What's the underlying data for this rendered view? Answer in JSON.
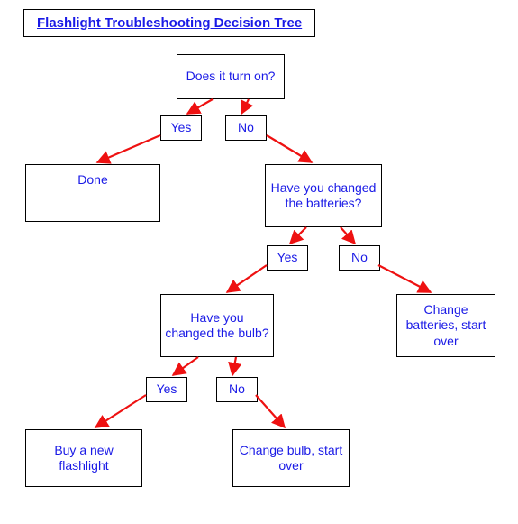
{
  "title": "Flashlight Troubleshooting Decision Tree",
  "nodes": {
    "q1": "Does it turn on?",
    "q1_yes": "Yes",
    "q1_no": "No",
    "done": "Done",
    "q2": "Have you changed the batteries?",
    "q2_yes": "Yes",
    "q2_no": "No",
    "change_batt": "Change batteries, start over",
    "q3": "Have you changed the bulb?",
    "q3_yes": "Yes",
    "q3_no": "No",
    "buy_new": "Buy a new flashlight",
    "change_bulb": "Change bulb, start over"
  },
  "chart_data": {
    "type": "decision-tree",
    "title": "Flashlight Troubleshooting Decision Tree",
    "root": "q1",
    "tree": {
      "q1": {
        "text": "Does it turn on?",
        "yes": "done",
        "no": "q2"
      },
      "done": {
        "text": "Done",
        "terminal": true
      },
      "q2": {
        "text": "Have you changed the batteries?",
        "yes": "q3",
        "no": "change_batt"
      },
      "change_batt": {
        "text": "Change batteries, start over",
        "terminal": true
      },
      "q3": {
        "text": "Have you changed the bulb?",
        "yes": "buy_new",
        "no": "change_bulb"
      },
      "buy_new": {
        "text": "Buy a new flashlight",
        "terminal": true
      },
      "change_bulb": {
        "text": "Change bulb, start over",
        "terminal": true
      }
    }
  }
}
